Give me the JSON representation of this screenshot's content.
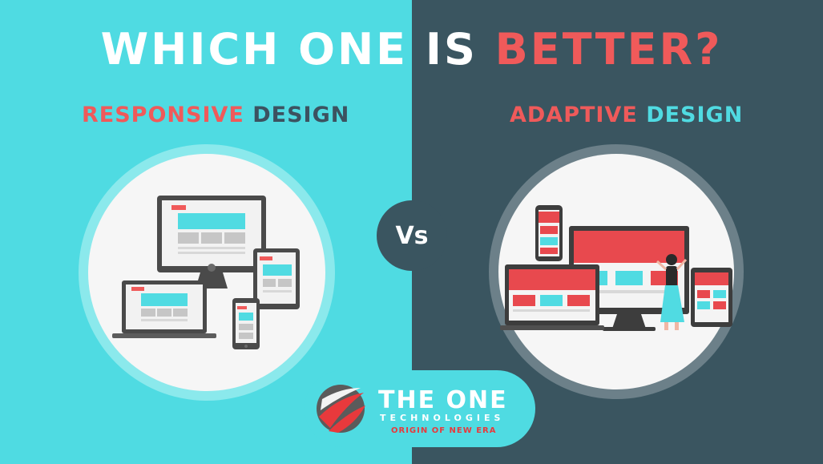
{
  "headline": {
    "part1": "WHICH ONE IS ",
    "part2": "BETTER?"
  },
  "left": {
    "word1": "RESPONSIVE",
    "word2": " DESIGN"
  },
  "right": {
    "word1": "ADAPTIVE",
    "word2": " DESIGN"
  },
  "vs": "Vs",
  "logo": {
    "title": "THE ONE",
    "subtitle": "TECHNOLOGIES",
    "tagline": "ORIGIN OF NEW ERA"
  },
  "colors": {
    "cyan": "#4fdbe2",
    "slate": "#3a5560",
    "red": "#ef5a5a"
  }
}
